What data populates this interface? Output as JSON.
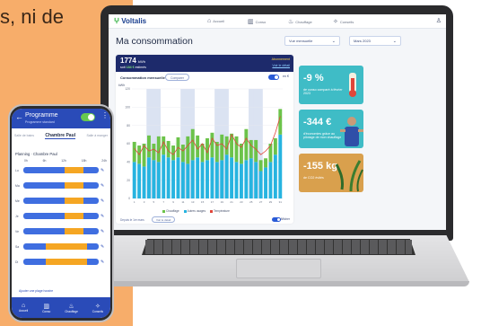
{
  "intro_text": "s, ni de",
  "app": {
    "brand": "Voltalis",
    "nav": [
      "Accueil",
      "Conso",
      "Chauffage",
      "Conseils"
    ],
    "title": "Ma consommation",
    "select_range": "Vue mensuelle",
    "select_month": "Mars 2023",
    "summary": {
      "kwh": "1774",
      "kwh_unit": "kWh",
      "cost_prefix": "soit",
      "cost": "184 €",
      "cost_suffix": "estimés",
      "subscription": "Abonnement",
      "details_link": "Voir le détail"
    },
    "chart_subtitle": "Consommation mensuelle",
    "chart_pill": "Comparer",
    "toggle_label": "en €",
    "foot_label": "Depuis le 1er mars",
    "foot_pill": "Voir le détail",
    "foot_toggle": "Afficher",
    "tips": [
      {
        "value": "-9 %",
        "text": "de conso comparé à février 2023"
      },
      {
        "value": "-344 €",
        "text": "d'économies grâce au pilotage de mon chauffage"
      },
      {
        "value": "-155 kg",
        "text": "de CO2 évités"
      }
    ]
  },
  "phone": {
    "title": "Programme",
    "subtitle": "Programme standard",
    "tabs": [
      "Salle de bains",
      "Chambre Paul",
      "Salle à manger"
    ],
    "planning_title": "Planning · Chambre Paul",
    "hours": [
      "0h",
      "6h",
      "12h",
      "18h",
      "24h"
    ],
    "rows": [
      {
        "day": "Lu",
        "comfort": [
          [
            0.55,
            0.8
          ]
        ]
      },
      {
        "day": "Ma",
        "comfort": [
          [
            0.55,
            0.8
          ]
        ]
      },
      {
        "day": "Me",
        "comfort": [
          [
            0.55,
            0.8
          ]
        ]
      },
      {
        "day": "Je",
        "comfort": [
          [
            0.55,
            0.8
          ]
        ]
      },
      {
        "day": "Ve",
        "comfort": [
          [
            0.55,
            0.8
          ]
        ]
      },
      {
        "day": "Sa",
        "comfort": [
          [
            0.3,
            0.85
          ]
        ]
      },
      {
        "day": "Di",
        "comfort": [
          [
            0.3,
            0.85
          ]
        ]
      }
    ],
    "add_link": "Ajouter une plage horaire",
    "nav": [
      "Accueil",
      "Conso",
      "Chauffage",
      "Conseils"
    ]
  },
  "colors": {
    "header_blue": "#1d2a6b",
    "heating_green": "#6cc34a",
    "other_blue": "#27b4e0",
    "temp_red": "#e0463a",
    "phone_blue": "#2a4bb8",
    "comfort_orange": "#f5a623",
    "eco_blue": "#3f6ee0"
  },
  "chart_data": {
    "type": "bar",
    "title": "Consommation mensuelle",
    "ylabel": "kWh",
    "ylim": [
      0,
      120
    ],
    "y_ticks": [
      0,
      20,
      40,
      60,
      80,
      100,
      120
    ],
    "categories": [
      "1",
      "2",
      "3",
      "4",
      "5",
      "6",
      "7",
      "8",
      "9",
      "10",
      "11",
      "12",
      "13",
      "14",
      "15",
      "16",
      "17",
      "18",
      "19",
      "20",
      "21",
      "22",
      "23",
      "24",
      "25",
      "26",
      "27",
      "28",
      "29",
      "30",
      "31"
    ],
    "highlight_days": [
      4,
      5,
      11,
      12,
      18,
      19,
      25,
      26
    ],
    "series": [
      {
        "name": "Chauffage",
        "type": "bar",
        "stacked": true,
        "values": [
          22,
          20,
          25,
          24,
          18,
          28,
          20,
          18,
          16,
          22,
          19,
          30,
          34,
          24,
          20,
          24,
          27,
          22,
          28,
          20,
          26,
          28,
          22,
          34,
          20,
          24,
          12,
          10,
          20,
          18,
          28
        ]
      },
      {
        "name": "Autres usages",
        "type": "bar",
        "stacked": true,
        "values": [
          40,
          38,
          35,
          45,
          42,
          40,
          48,
          45,
          42,
          45,
          40,
          38,
          42,
          45,
          40,
          42,
          45,
          40,
          42,
          48,
          45,
          40,
          38,
          42,
          44,
          40,
          30,
          34,
          40,
          48,
          70
        ]
      },
      {
        "name": "Température",
        "type": "line",
        "values": [
          55,
          48,
          58,
          52,
          54,
          50,
          62,
          52,
          48,
          56,
          52,
          58,
          64,
          54,
          60,
          50,
          66,
          58,
          60,
          54,
          70,
          60,
          56,
          66,
          58,
          54,
          48,
          52,
          58,
          72,
          90
        ]
      }
    ]
  }
}
